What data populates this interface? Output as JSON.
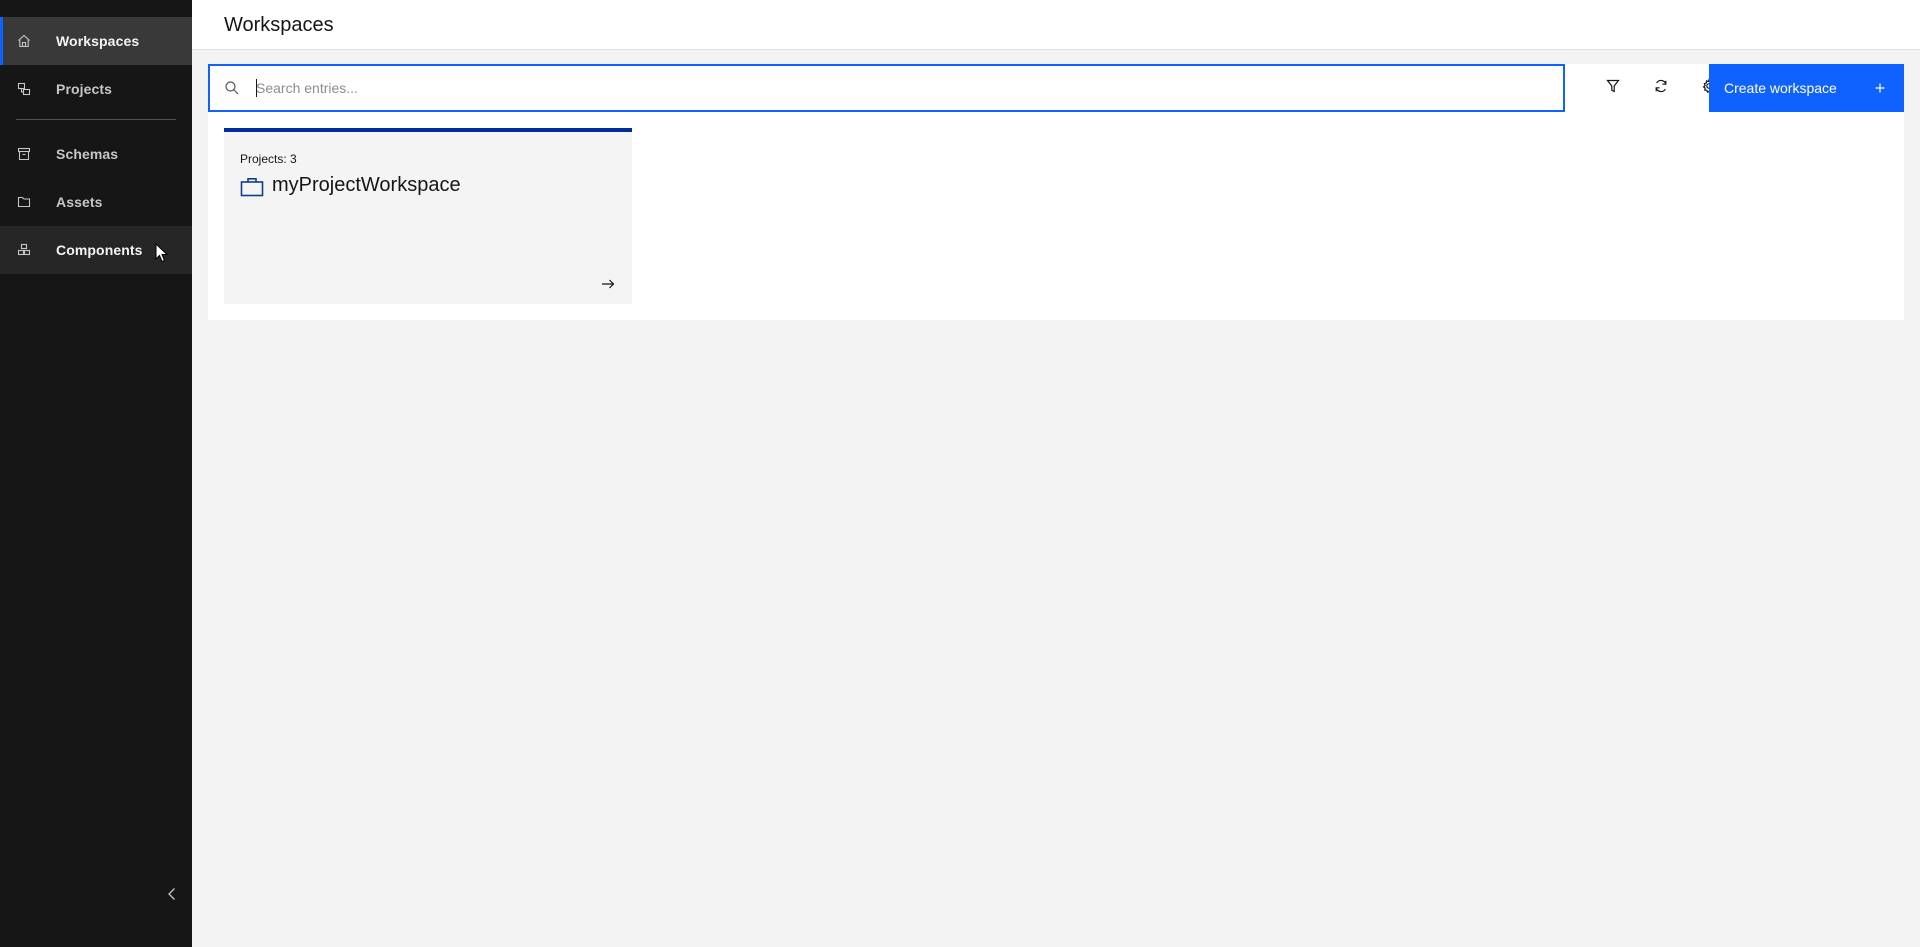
{
  "sidebar": {
    "items": [
      {
        "label": "Workspaces",
        "icon": "home-icon"
      },
      {
        "label": "Projects",
        "icon": "projects-icon"
      },
      {
        "label": "Schemas",
        "icon": "archive-icon"
      },
      {
        "label": "Assets",
        "icon": "folder-icon"
      },
      {
        "label": "Components",
        "icon": "components-icon"
      }
    ],
    "active_item": "Workspaces",
    "collapse_icon": "chevron-left-icon"
  },
  "header": {
    "title": "Workspaces"
  },
  "toolbar": {
    "search_placeholder": "Search entries...",
    "search_value": "",
    "filter_icon": "filter-icon",
    "refresh_icon": "refresh-icon",
    "settings_icon": "settings-icon",
    "create_label": "Create workspace",
    "create_icon": "plus-icon"
  },
  "workspaces": [
    {
      "meta": "Projects: 3",
      "name": "myProjectWorkspace",
      "icon": "briefcase-icon"
    }
  ],
  "colors": {
    "sidebar_bg": "#161616",
    "accent": "#0f62fe",
    "tile_border": "#002d9c",
    "page_bg": "#f3f3f3"
  }
}
